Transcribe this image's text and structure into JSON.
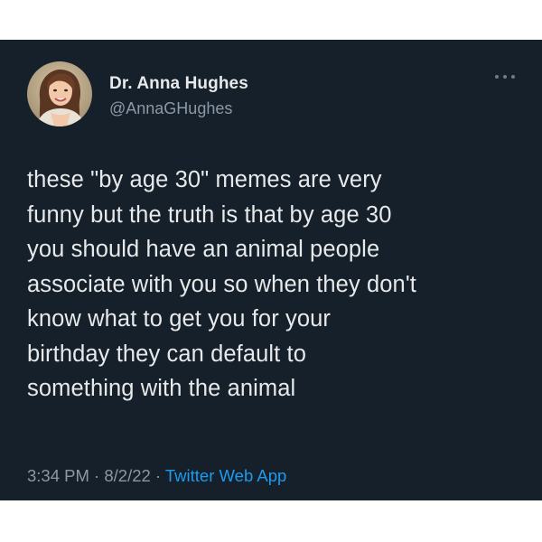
{
  "author": {
    "display_name": "Dr. Anna Hughes",
    "handle": "@AnnaGHughes",
    "avatar_icon": "profile-photo"
  },
  "more_icon": "more-horizontal-icon",
  "tweet": {
    "text": "these \"by age 30\" memes are very\nfunny but the truth is that by age 30\nyou should have an animal people\nassociate with you so when they don't\nknow what to get you for your\nbirthday they can default to\nsomething with the animal"
  },
  "meta": {
    "time": "3:34 PM",
    "separator": " · ",
    "date": "8/2/22",
    "source": "Twitter Web App"
  },
  "colors": {
    "background": "#15202b",
    "text": "#e7e9ea",
    "secondary": "#8b98a5",
    "link": "#1d9bf0"
  }
}
